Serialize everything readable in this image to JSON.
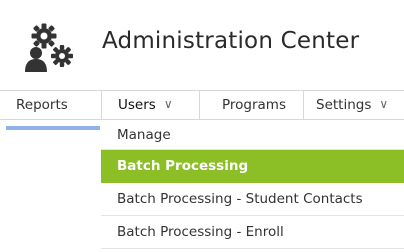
{
  "header": {
    "title": "Administration Center",
    "logo_icon": "admin-gears-user-icon"
  },
  "nav": {
    "tabs": [
      {
        "label": "Reports"
      },
      {
        "label": "Users",
        "icon": "chevron-down-icon",
        "open": true
      },
      {
        "label": "Programs"
      },
      {
        "label": "Settings",
        "icon": "chevron-down-icon"
      }
    ],
    "chevron": "∨"
  },
  "users_menu": {
    "items": [
      {
        "label": "Manage"
      },
      {
        "label": "Batch Processing",
        "selected": true
      },
      {
        "label": "Batch Processing - Student Contacts"
      },
      {
        "label": "Batch Processing - Enroll"
      }
    ]
  },
  "colors": {
    "selected_bg": "#8cbf26",
    "active_indicator": "#8fb3e8"
  }
}
